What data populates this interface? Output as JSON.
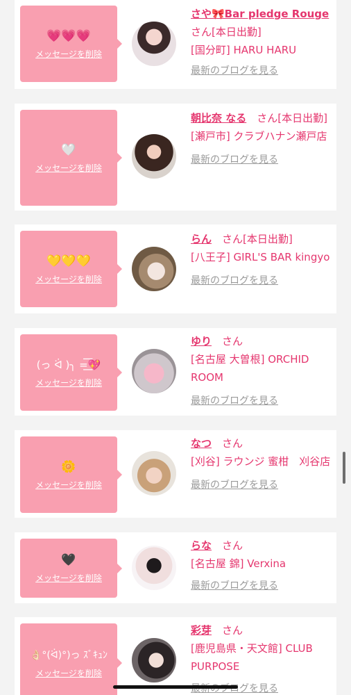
{
  "delete_label": "メッセージを削除",
  "san": "さん",
  "blog_label": "最新のブログを見る",
  "colors": {
    "accent": "#e5366e",
    "bubble": "#f99fb0",
    "link_gray": "#9a9a9a"
  },
  "cards": [
    {
      "message": "💗💗💗",
      "name": "さや🎀Bar pledge Rouge",
      "status": "[本日出勤]",
      "shop": "[国分町] HARU HARU",
      "avatar_icon": "avatar-photo"
    },
    {
      "message": "🤍",
      "name": "朝比奈 なる",
      "status": "[本日出勤]",
      "shop": "[瀬戸市] クラブハナン瀬戸店",
      "avatar_icon": "avatar-photo"
    },
    {
      "message": "💛💛💛",
      "name": "らん",
      "status": "[本日出勤]",
      "shop": "[八王子] GIRL'S BAR kingyo",
      "avatar_icon": "avatar-photo"
    },
    {
      "message": "(っ ᐛ )╮ =͟͟͞͞💖",
      "name": "ゆり",
      "status": "",
      "shop": "[名古屋 大曽根] ORCHID ROOM",
      "avatar_icon": "avatar-photo"
    },
    {
      "message": "🌼",
      "name": "なつ",
      "status": "",
      "shop": "[刈谷] ラウンジ 蜜柑　刈谷店",
      "avatar_icon": "avatar-photo"
    },
    {
      "message": "🖤",
      "name": "らな",
      "status": "",
      "shop": "[名古屋 錦] Verxina",
      "avatar_icon": "avatar-photo"
    },
    {
      "message": "👌🏻°(ᐛ)°)っ ｽﾞｷｭﾝ",
      "name": "彩芽",
      "status": "",
      "shop": "[鹿児島県・天文館] CLUB PURPOSE",
      "avatar_icon": "avatar-photo"
    }
  ]
}
